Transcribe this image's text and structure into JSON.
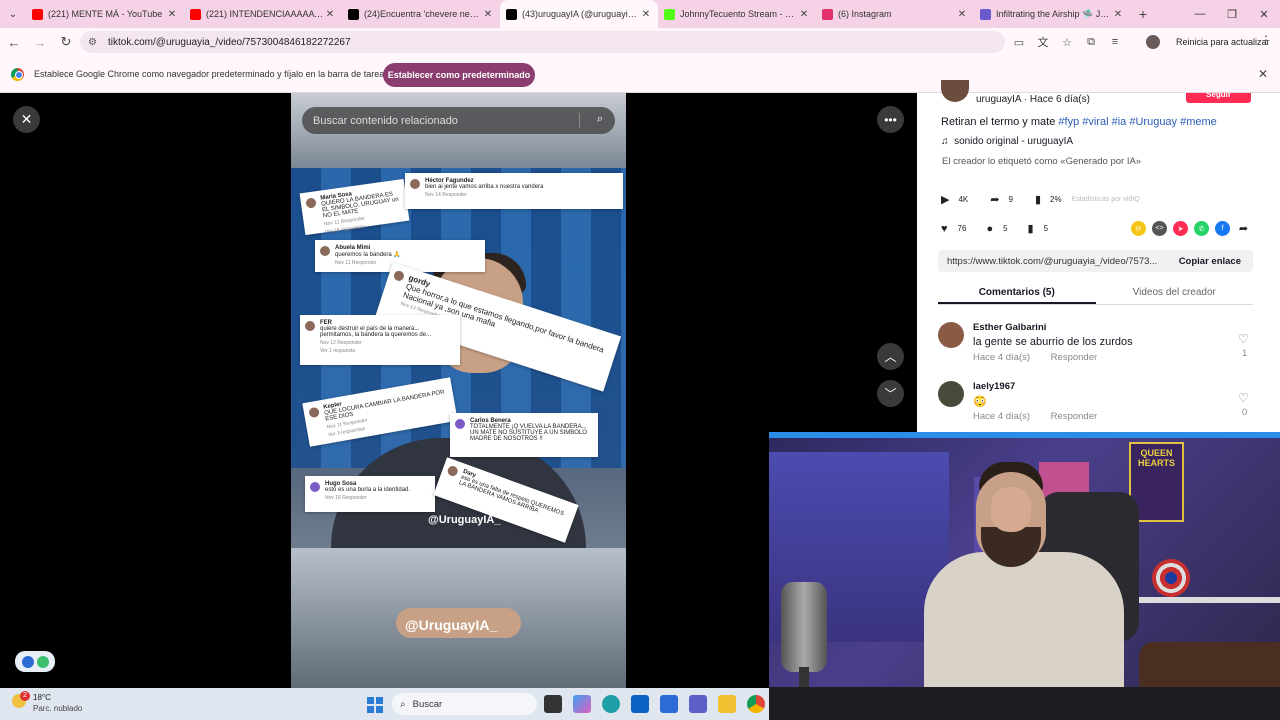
{
  "browser": {
    "tabs": [
      {
        "label": "(221) MENTE MÁ - YouTube",
        "color": "#ff0000"
      },
      {
        "label": "(221) INTENDENCIAAAAA | CLUB",
        "color": "#ff0000"
      },
      {
        "label": "(24)Encuentra 'chevere negron'",
        "color": "#000000"
      },
      {
        "label": "(43)uruguayIA (@uruguayia_) |",
        "color": "#000000"
      },
      {
        "label": "JohnnyTecuento Stream - Watc",
        "color": "#53fc18"
      },
      {
        "label": "(6) Instagram",
        "color": "#e1306c"
      },
      {
        "label": "Infiltrating the Airship 🛸 Jueg",
        "color": "#6a5acd"
      }
    ],
    "url": "tiktok.com/@uruguayia_/video/7573004846182272267",
    "update_label": "Reinicia para actualizar"
  },
  "infobar": {
    "text": "Establece Google Chrome como navegador predeterminado y fíjalo en la barra de tareas",
    "button": "Establecer como predeterminado"
  },
  "video": {
    "search_placeholder": "Buscar contenido relacionado",
    "watermark": "@UruguayIA_",
    "watermark_small": "@UruguayIA_",
    "cards": [
      {
        "name": "Maria Sosa",
        "text": "QUIERO LA BANDERA ES EL SIMBOLO, URUGUAY un NO EL MATE",
        "meta": "Nov 11    Responder",
        "sub": "Ver 16 respuestas"
      },
      {
        "name": "Héctor Fagundez",
        "text": "bien ai jente vamos arriba x nuestra vandera",
        "meta": "Nov 14    Responder",
        "sub": ""
      },
      {
        "name": "Abuela Mimi",
        "text": "queremos la bandera 🙏",
        "meta": "Nov 11    Responder",
        "sub": ""
      },
      {
        "name": "gordy",
        "text": "Que horror,a lo que estamos llegando,por favor la bandera Nacional ya ,son una mafia",
        "meta": "Nov 13    Responder",
        "sub": ""
      },
      {
        "name": "FER",
        "text": "quiere destruir el país de la manera... permitamos, la bandera la queremos de...",
        "meta": "Nov 12    Responder",
        "sub": "Ver 1 respuesta"
      },
      {
        "name": "Kepler",
        "text": "QUE LOCURA CAMBIAR LA BANDERA POR ESE DIOS",
        "meta": "Nov 11    Responder",
        "sub": "Ver 3 respuestas"
      },
      {
        "name": "Carlos Benera",
        "text": "TOTALMENTE ¡Q VUELVA LA BANDERA... UN MATE NO SUSTITUYE A UN SIMBOLO MADRE DE NOSOTROS !!",
        "meta": "",
        "sub": ""
      },
      {
        "name": "Hugo Sosa",
        "text": "esto es una burla a la identidad.",
        "meta": "Nov 16    Responder",
        "sub": ""
      },
      {
        "name": "Dary",
        "text": "eso es una falta de respeto QUEREMOS LA BANDERA VAMOS ARRIBA",
        "meta": "",
        "sub": ""
      }
    ]
  },
  "panel": {
    "author": "uruguayIA · Hace 6 día(s)",
    "follow": "Seguir",
    "desc_text": "Retiran el termo y mate",
    "hashtags": [
      "#fyp",
      "#viral",
      "#ia",
      "#Uruguay",
      "#meme"
    ],
    "sound": "sonido original - uruguayIA",
    "ai_label": "El creador lo etiquetó como «Generado por IA»",
    "plays": "4K",
    "shares": "9",
    "analytics": "2%",
    "analytics_note": "Estadísticas por vidIQ",
    "likes": "76",
    "comments_count": "5",
    "saves": "5",
    "link": "https://www.tiktok.com/@uruguayia_/video/7573...",
    "copy_label": "Copiar enlace",
    "tab_comments": "Comentarios (5)",
    "tab_videos": "Videos del creador",
    "comments": [
      {
        "name": "Esther Galbarini",
        "text": "la gente se aburrio de los zurdos",
        "time": "Hace 4 día(s)",
        "reply": "Responder",
        "likes": "1"
      },
      {
        "name": "laely1967",
        "text": "😳",
        "time": "Hace 4 día(s)",
        "reply": "Responder",
        "likes": "0"
      }
    ]
  },
  "cam": {
    "poster": "QUEEN HEARTS"
  },
  "taskbar": {
    "temp": "18°C",
    "condition": "Parc. nublado",
    "search": "Buscar",
    "badge": "2"
  }
}
